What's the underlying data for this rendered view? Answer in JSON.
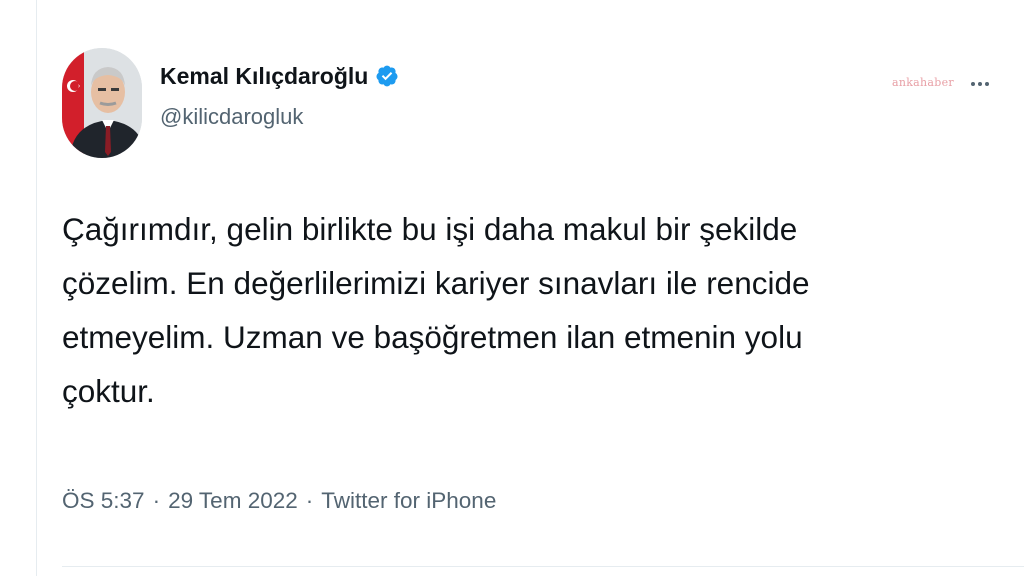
{
  "tweet": {
    "author": {
      "display_name": "Kemal Kılıçdaroğlu",
      "handle": "@kilicdarogluk",
      "verified": true,
      "verified_icon": "verified-badge-icon",
      "avatar": "profile-photo"
    },
    "text": "Çağırımdır, gelin birlikte bu işi daha makul bir şekilde\nçözelim. En değerlilerimizi kariyer sınavları ile rencide\netmeyelim. Uzman ve başöğretmen ilan etmenin yolu\nçoktur.",
    "time": "ÖS 5:37",
    "separator": "·",
    "date": "29 Tem 2022",
    "source": "Twitter for iPhone",
    "more_icon": "more-options-icon"
  },
  "watermark": "ankahaber",
  "colors": {
    "text": "#0f1419",
    "secondary": "#536471",
    "verified": "#1d9bf0",
    "divider": "#e6ecf0"
  }
}
